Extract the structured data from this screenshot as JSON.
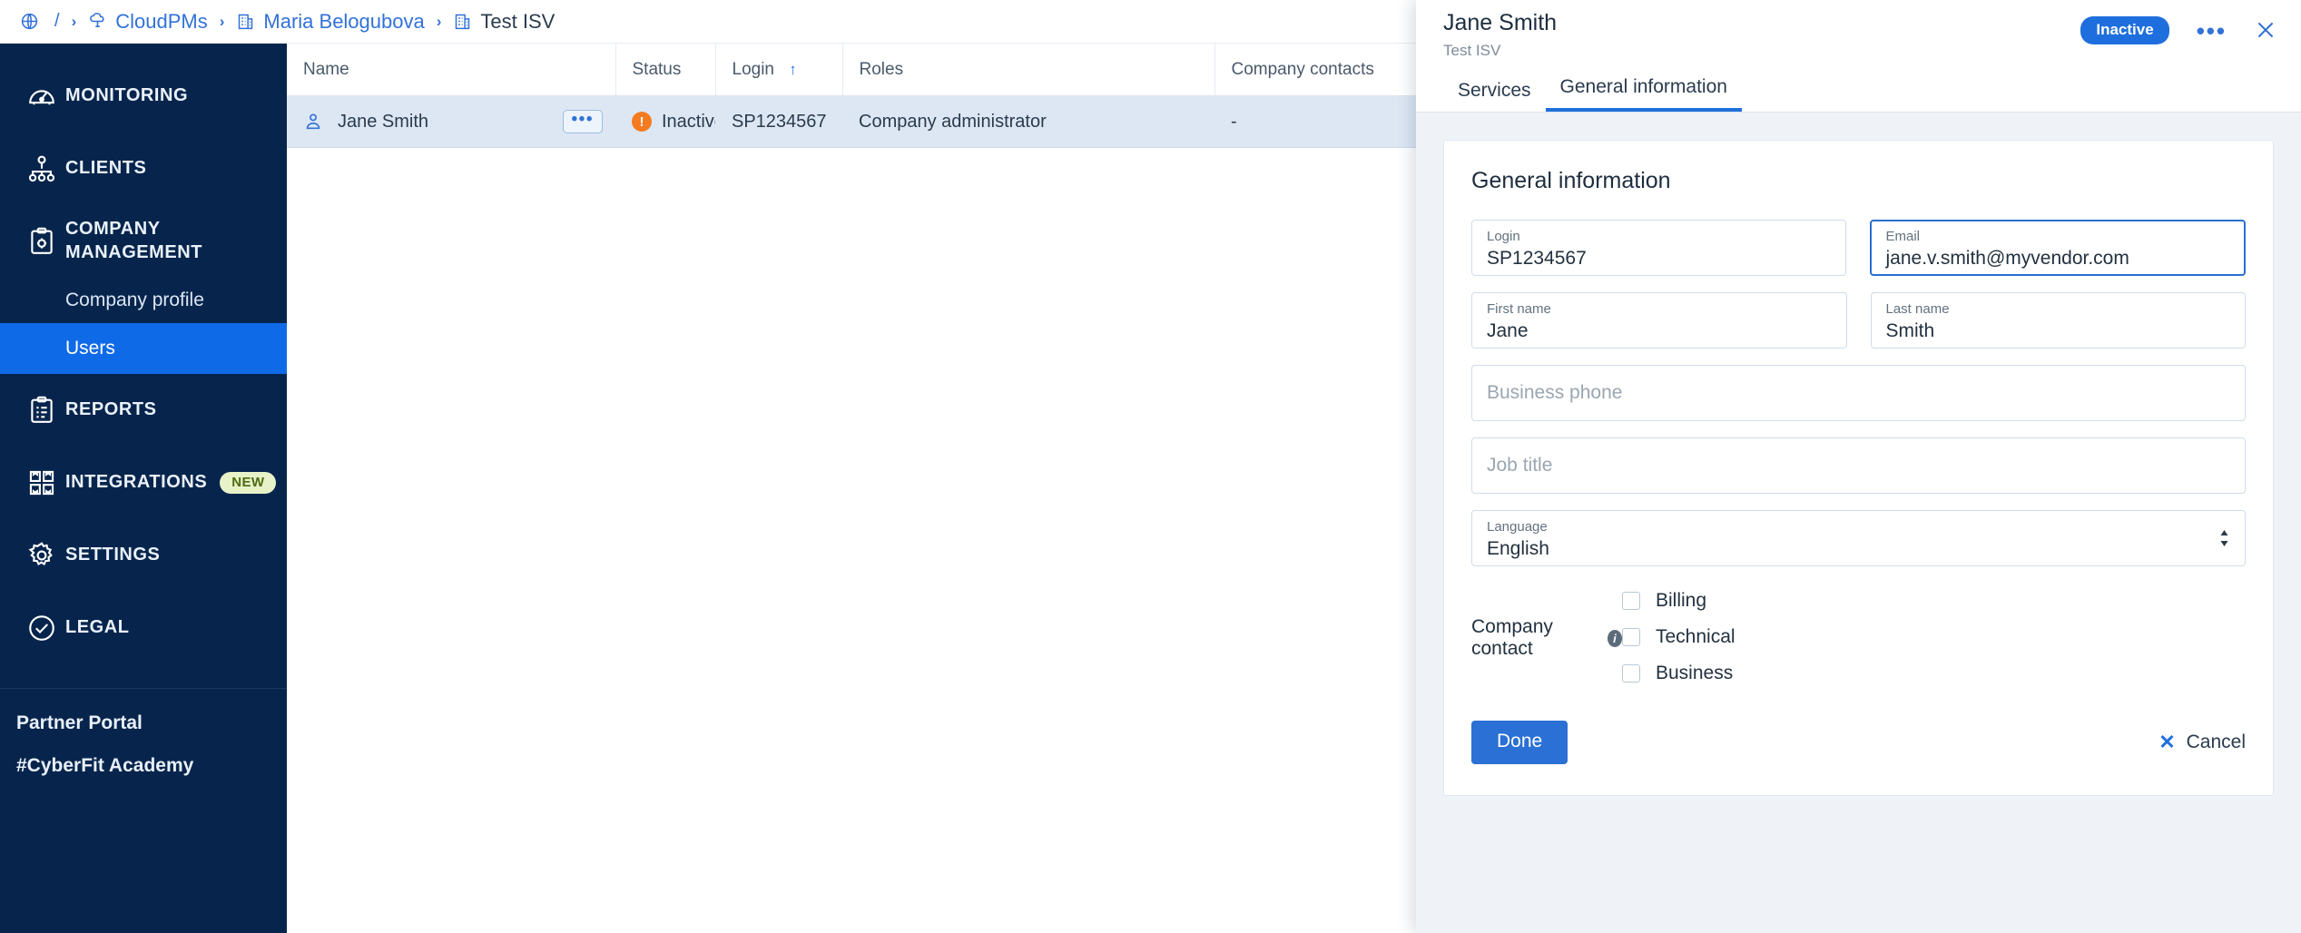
{
  "breadcrumb": {
    "root_icon": "globe-icon",
    "slash": "/",
    "items": [
      {
        "label": "CloudPMs",
        "icon": "cloud-icon"
      },
      {
        "label": "Maria Belogubova",
        "icon": "building-icon"
      },
      {
        "label": "Test ISV",
        "icon": "building-icon"
      }
    ],
    "separator": "›"
  },
  "sidebar": {
    "items": [
      {
        "label": "MONITORING",
        "icon": "gauge-icon"
      },
      {
        "label": "CLIENTS",
        "icon": "org-chart-icon"
      },
      {
        "label": "COMPANY MANAGEMENT",
        "icon": "clipboard-gear-icon"
      },
      {
        "label": "REPORTS",
        "icon": "clipboard-list-icon"
      },
      {
        "label": "INTEGRATIONS",
        "icon": "grid-boxes-icon",
        "badge": "NEW"
      },
      {
        "label": "SETTINGS",
        "icon": "gear-icon"
      },
      {
        "label": "LEGAL",
        "icon": "check-circle-icon"
      }
    ],
    "sub_items": [
      {
        "label": "Company profile",
        "active": false
      },
      {
        "label": "Users",
        "active": true
      }
    ],
    "footer_links": [
      {
        "label": "Partner Portal"
      },
      {
        "label": "#CyberFit Academy"
      }
    ]
  },
  "table": {
    "columns": [
      "Name",
      "Status",
      "Login",
      "Roles",
      "Company contacts"
    ],
    "sorted_column": "Login",
    "sort_direction": "↑",
    "rows": [
      {
        "name": "Jane Smith",
        "status": "Inactive",
        "status_symbol": "!",
        "login": "SP1234567",
        "roles": "Company administrator",
        "company_contacts": "-",
        "row_menu": "•••"
      }
    ]
  },
  "panel": {
    "title": "Jane Smith",
    "subtitle": "Test ISV",
    "status_pill": "Inactive",
    "menu_dots": "•••",
    "close_icon": "close-icon",
    "tabs": [
      {
        "label": "Services",
        "active": false
      },
      {
        "label": "General information",
        "active": true
      }
    ],
    "form": {
      "section_title": "General information",
      "login": {
        "label": "Login",
        "value": "SP1234567"
      },
      "email": {
        "label": "Email",
        "value": "jane.v.smith@myvendor.com",
        "focused": true
      },
      "first_name": {
        "label": "First name",
        "value": "Jane"
      },
      "last_name": {
        "label": "Last name",
        "value": "Smith"
      },
      "business_phone": {
        "placeholder": "Business phone",
        "value": ""
      },
      "job_title": {
        "placeholder": "Job title",
        "value": ""
      },
      "language": {
        "label": "Language",
        "value": "English"
      },
      "company_contact": {
        "label": "Company contact",
        "info": "i",
        "options": [
          {
            "label": "Billing",
            "checked": false
          },
          {
            "label": "Technical",
            "checked": false
          },
          {
            "label": "Business",
            "checked": false
          }
        ]
      },
      "done_button": "Done",
      "cancel_button": "Cancel",
      "cancel_icon": "✕"
    }
  },
  "colors": {
    "sidebar_bg": "#07254c",
    "accent_blue": "#1f6fdd",
    "active_item": "#0f6ae8",
    "status_orange": "#f47b20",
    "badge_bg": "#e7f2c8",
    "row_selected": "#dde7f3"
  }
}
